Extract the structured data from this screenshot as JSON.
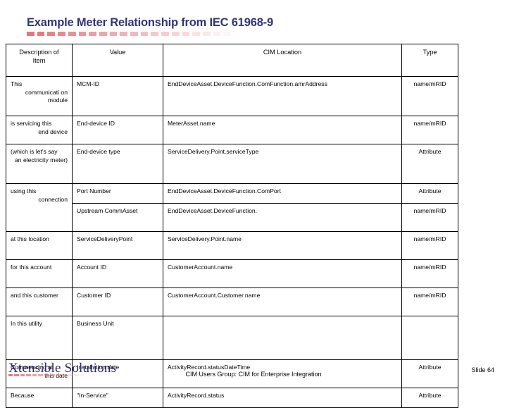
{
  "slide": {
    "title": "Example Meter Relationship from IEC 61968-9",
    "title_color": "#33347a",
    "accent_color": "#e8737a",
    "slide_number_label": "Slide 64",
    "footer_text": "CIM Users Group: CIM for Enterprise Integration",
    "logo_text": "Xtensible Solutions",
    "logo_color": "#2b2b66"
  },
  "table": {
    "headers": [
      "Description of Item",
      "Value",
      "CIM Location",
      "Type"
    ],
    "headers_lines": {
      "desc_line1": "Description of",
      "desc_line2": "Item",
      "value": "Value",
      "cim": "CIM Location",
      "type": "Type"
    },
    "rows": [
      {
        "desc_lead": "This",
        "desc_cont": "communicati on module",
        "value": "MCM-ID",
        "cim": "EndDeviceAsset.DeviceFunction.ComFunction.amrAddress",
        "type": "name/mRID"
      },
      {
        "desc_lead": "is servicing this",
        "desc_cont": "end device",
        "value": "End-device ID",
        "cim": "MeterAsset.name",
        "type": "name/mRID"
      },
      {
        "desc_lead": "(which is let's say",
        "desc_cont": "an electricity meter)",
        "value": "End-device type",
        "cim": "ServiceDelivery.Point.serviceType",
        "type": "Attribute"
      },
      {
        "desc_lead": "using this",
        "desc_cont": "connection",
        "value": "Port Number",
        "cim": "EndDeviceAsset.DeviceFunction.ComPort",
        "type": "Attribute"
      },
      {
        "desc_lead": "",
        "desc_cont": "",
        "value": "Upstream CommAsset",
        "cim": "EndDeviceAsset.DeviceFunction.",
        "type": "name/mRID"
      },
      {
        "desc_lead": "at this location",
        "desc_cont": "",
        "value": "ServiceDeliveryPoint",
        "cim": "ServiceDelivery.Point.name",
        "type": "name/mRID"
      },
      {
        "desc_lead": "for this account",
        "desc_cont": "",
        "value": "Account ID",
        "cim": "CustomerAccount.name",
        "type": "name/mRID"
      },
      {
        "desc_lead": "and this customer",
        "desc_cont": "",
        "value": "Customer ID",
        "cim": "CustomerAccount.Customer.name",
        "type": "name/mRID"
      },
      {
        "desc_lead": "In this utility",
        "desc_cont": "",
        "value": "Business Unit",
        "cim": "",
        "type": ""
      },
      {
        "desc_lead": "Commencing at",
        "desc_cont": "this date",
        "value": "Installation date",
        "cim": "ActivityRecord.statusDateTime",
        "type": "Attribute"
      },
      {
        "desc_lead": "Because",
        "desc_cont": "",
        "value": "\"In-Service\"",
        "cim": "ActivityRecord.status",
        "type": "Attribute"
      }
    ]
  }
}
